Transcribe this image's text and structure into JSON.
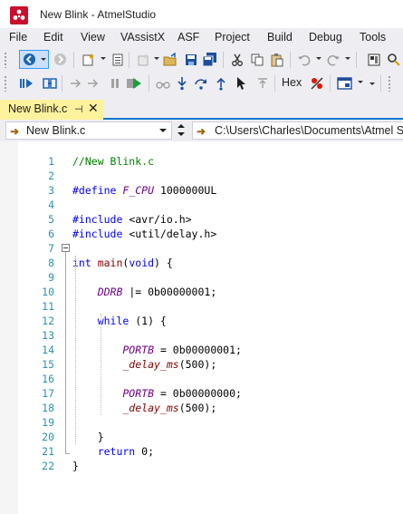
{
  "window": {
    "title": "New Blink - AtmelStudio"
  },
  "menu": [
    "File",
    "Edit",
    "View",
    "VAssistX",
    "ASF",
    "Project",
    "Build",
    "Debug",
    "Tools"
  ],
  "toolbar": {
    "hex_label": "Hex"
  },
  "tab": {
    "label": "New Blink.c",
    "pin": "⊣",
    "close": "✕"
  },
  "nav": {
    "file_label": "New Blink.c",
    "path": "C:\\Users\\Charles\\Documents\\Atmel Stu"
  },
  "colors": {
    "accent": "#007acc",
    "tab_active": "#fff29d",
    "line_number": "#2b91af",
    "comment": "#008000",
    "keyword": "#0000ff"
  },
  "editor": {
    "lines": [
      {
        "n": "1",
        "tokens": [
          {
            "t": "//New Blink.c",
            "c": "c-comment"
          }
        ]
      },
      {
        "n": "2",
        "tokens": []
      },
      {
        "n": "3",
        "tokens": [
          {
            "t": "#define ",
            "c": "c-kw"
          },
          {
            "t": "F_CPU",
            "c": "c-macro"
          },
          {
            "t": " 1000000UL",
            "c": "c-num"
          }
        ]
      },
      {
        "n": "4",
        "tokens": []
      },
      {
        "n": "5",
        "tokens": [
          {
            "t": "#include ",
            "c": "c-kw"
          },
          {
            "t": "<avr/io.h>",
            "c": "c-num"
          }
        ]
      },
      {
        "n": "6",
        "tokens": [
          {
            "t": "#include ",
            "c": "c-kw"
          },
          {
            "t": "<util/delay.h>",
            "c": "c-num"
          }
        ]
      },
      {
        "n": "7",
        "tokens": []
      },
      {
        "n": "8",
        "tokens": [
          {
            "t": "int ",
            "c": "c-kw"
          },
          {
            "t": "main",
            "c": "c-ident"
          },
          {
            "t": "(",
            "c": "c-num"
          },
          {
            "t": "void",
            "c": "c-kw"
          },
          {
            "t": ") {",
            "c": "c-num"
          }
        ]
      },
      {
        "n": "9",
        "tokens": []
      },
      {
        "n": "10",
        "tokens": [
          {
            "t": "    DDRB",
            "c": "c-macro"
          },
          {
            "t": " |= 0b00000001;",
            "c": "c-num"
          }
        ]
      },
      {
        "n": "11",
        "tokens": []
      },
      {
        "n": "12",
        "tokens": [
          {
            "t": "    while",
            "c": "c-kw"
          },
          {
            "t": " (1) {",
            "c": "c-num"
          }
        ]
      },
      {
        "n": "13",
        "tokens": []
      },
      {
        "n": "14",
        "tokens": [
          {
            "t": "        PORTB",
            "c": "c-macro"
          },
          {
            "t": " = 0b00000001;",
            "c": "c-num"
          }
        ]
      },
      {
        "n": "15",
        "tokens": [
          {
            "t": "        _delay_ms",
            "c": "c-func"
          },
          {
            "t": "(500);",
            "c": "c-num"
          }
        ]
      },
      {
        "n": "16",
        "tokens": []
      },
      {
        "n": "17",
        "tokens": [
          {
            "t": "        PORTB",
            "c": "c-macro"
          },
          {
            "t": " = 0b00000000;",
            "c": "c-num"
          }
        ]
      },
      {
        "n": "18",
        "tokens": [
          {
            "t": "        _delay_ms",
            "c": "c-func"
          },
          {
            "t": "(500);",
            "c": "c-num"
          }
        ]
      },
      {
        "n": "19",
        "tokens": []
      },
      {
        "n": "20",
        "tokens": [
          {
            "t": "    }",
            "c": "c-num"
          }
        ]
      },
      {
        "n": "21",
        "tokens": [
          {
            "t": "    return",
            "c": "c-kw"
          },
          {
            "t": " 0;",
            "c": "c-num"
          }
        ]
      },
      {
        "n": "22",
        "tokens": [
          {
            "t": "}",
            "c": "c-num"
          }
        ]
      }
    ]
  }
}
